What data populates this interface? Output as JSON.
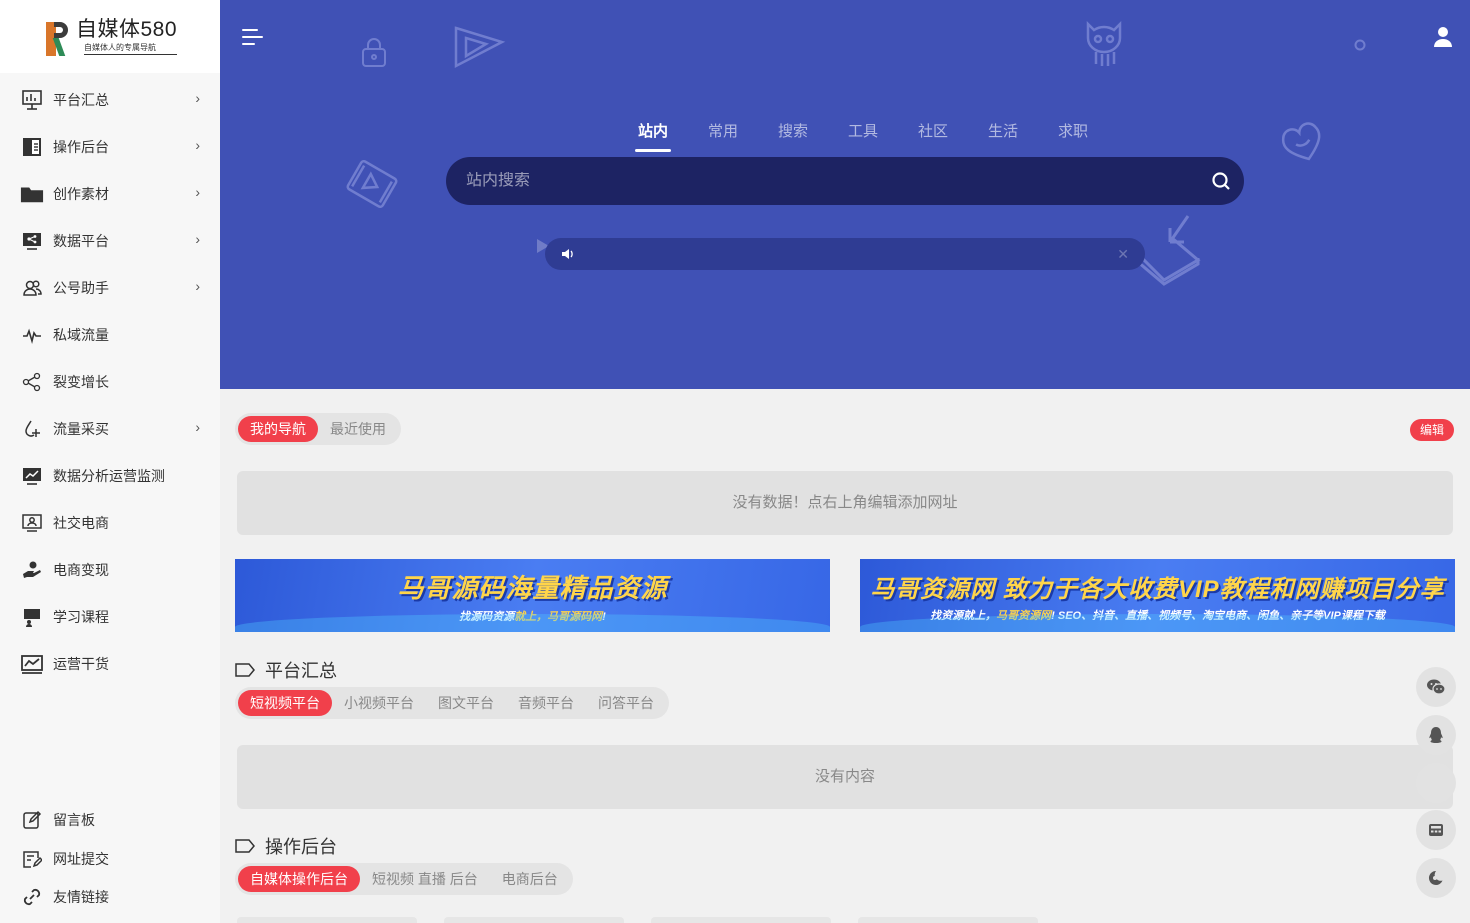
{
  "logo": {
    "title": "自媒体580",
    "subtitle": "自媒体人的专属导航"
  },
  "sidebar": {
    "items": [
      {
        "label": "平台汇总",
        "icon": "chart-board-icon",
        "has_arrow": true
      },
      {
        "label": "操作后台",
        "icon": "book-icon",
        "has_arrow": true
      },
      {
        "label": "创作素材",
        "icon": "folder-icon",
        "has_arrow": true
      },
      {
        "label": "数据平台",
        "icon": "share-screen-icon",
        "has_arrow": true
      },
      {
        "label": "公号助手",
        "icon": "users-icon",
        "has_arrow": true
      },
      {
        "label": "私域流量",
        "icon": "pulse-icon",
        "has_arrow": false
      },
      {
        "label": "裂变增长",
        "icon": "share-nodes-icon",
        "has_arrow": false
      },
      {
        "label": "流量采买",
        "icon": "drop-plus-icon",
        "has_arrow": true
      },
      {
        "label": "数据分析运营监测",
        "icon": "line-chart-icon",
        "has_arrow": false
      },
      {
        "label": "社交电商",
        "icon": "monitor-user-icon",
        "has_arrow": false
      },
      {
        "label": "电商变现",
        "icon": "hand-money-icon",
        "has_arrow": false
      },
      {
        "label": "学习课程",
        "icon": "teacher-icon",
        "has_arrow": false
      },
      {
        "label": "运营干货",
        "icon": "trend-chart-icon",
        "has_arrow": false
      }
    ],
    "bottom_items": [
      {
        "label": "留言板",
        "icon": "edit-icon"
      },
      {
        "label": "网址提交",
        "icon": "form-icon"
      },
      {
        "label": "友情链接",
        "icon": "link-icon"
      }
    ]
  },
  "hero": {
    "tabs": [
      "站内",
      "常用",
      "搜索",
      "工具",
      "社区",
      "生活",
      "求职"
    ],
    "active_tab": 0,
    "search_placeholder": "站内搜索",
    "notice_text": ""
  },
  "my_nav": {
    "tabs": [
      "我的导航",
      "最近使用"
    ],
    "edit_label": "编辑",
    "empty_text": "没有数据！点右上角编辑添加网址"
  },
  "banners": [
    {
      "title": "马哥源码海量精品资源",
      "subtitle_pre": "找源码资源",
      "subtitle_hl": "就上，马哥源码网",
      "subtitle_post": "!"
    },
    {
      "title": "马哥资源网 致力于各大收费VIP教程和网赚项目分享",
      "subtitle_pre": "找资源就上，",
      "subtitle_hl": "马哥资源网",
      "subtitle_post": "! SEO、抖音、直播、视频号、淘宝电商、闲鱼、亲子等VIP课程下载"
    }
  ],
  "sections": [
    {
      "title": "平台汇总",
      "tabs": [
        "短视频平台",
        "小视频平台",
        "图文平台",
        "音频平台",
        "问答平台"
      ],
      "empty_text": "没有内容"
    },
    {
      "title": "操作后台",
      "tabs": [
        "自媒体操作后台",
        "短视频 直播 后台",
        "电商后台"
      ]
    }
  ],
  "colors": {
    "hero": "#4051b5",
    "search": "#1d2363",
    "accent": "#f1404b"
  }
}
